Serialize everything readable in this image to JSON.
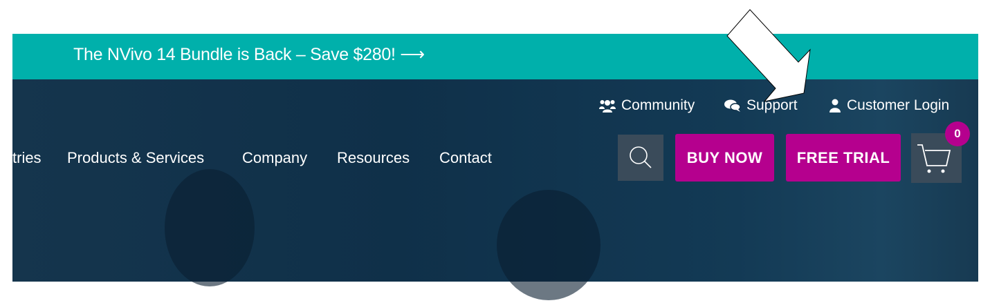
{
  "banner": {
    "text": "The NVivo 14 Bundle is Back – Save $280!",
    "arrow_glyph": "⟶",
    "color": "#00b0ab"
  },
  "utility_nav": [
    {
      "label": "Community",
      "icon": "users-icon"
    },
    {
      "label": "Support",
      "icon": "comments-icon"
    },
    {
      "label": "Customer Login",
      "icon": "user-icon"
    }
  ],
  "main_nav": [
    {
      "label": "tries"
    },
    {
      "label": "Products & Services"
    },
    {
      "label": "Company"
    },
    {
      "label": "Resources"
    },
    {
      "label": "Contact"
    }
  ],
  "actions": {
    "buy_now": "BUY NOW",
    "free_trial": "FREE TRIAL",
    "cart_count": "0",
    "accent": "#b5008e"
  }
}
